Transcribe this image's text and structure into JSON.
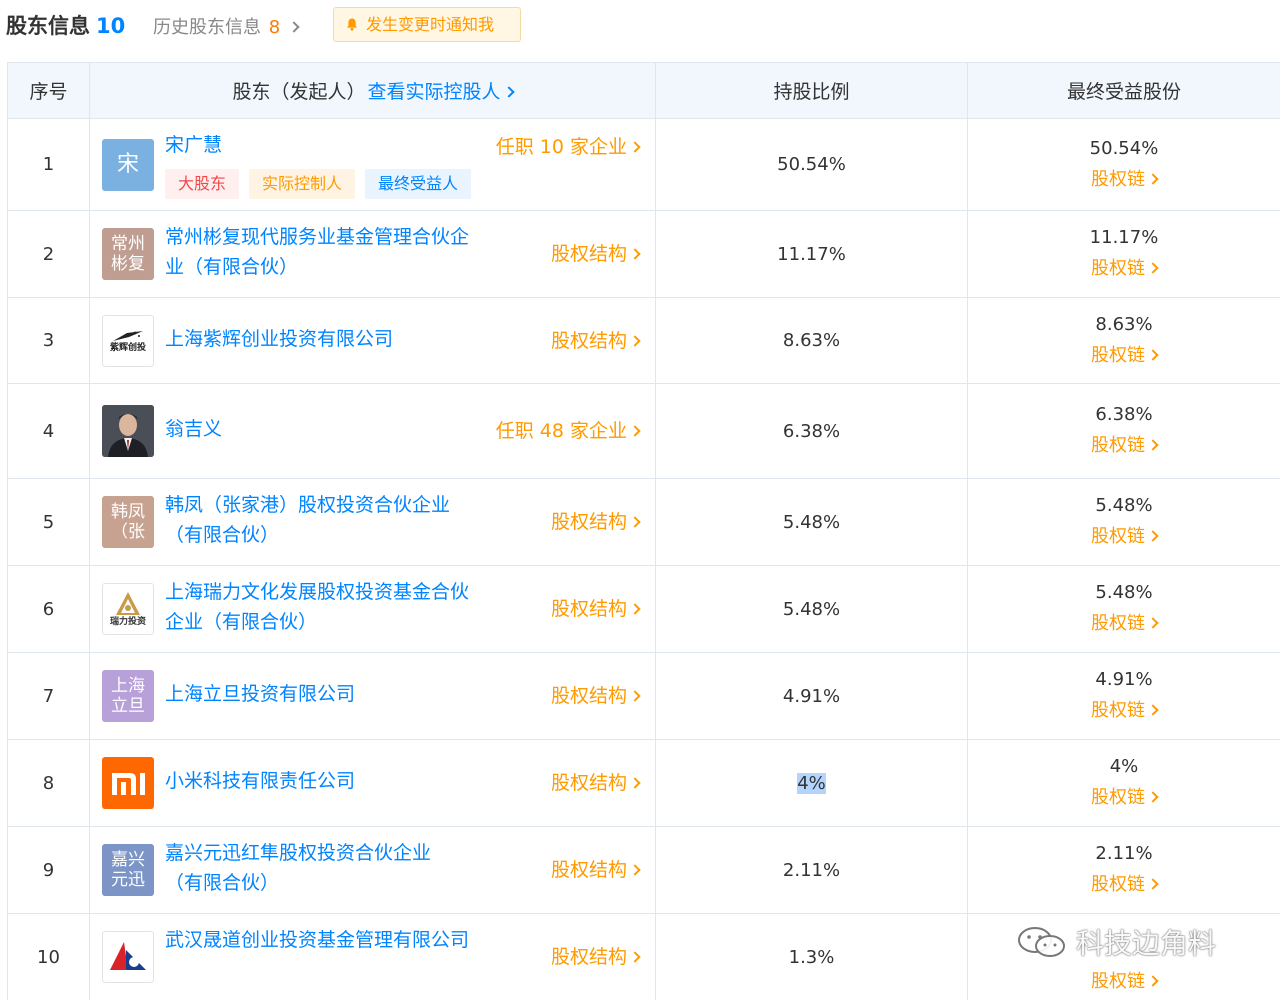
{
  "header": {
    "title": "股东信息",
    "title_count": "10",
    "history_label": "历史股东信息",
    "history_count": "8",
    "notify_label": "发生变更时通知我"
  },
  "table": {
    "columns": {
      "index": "序号",
      "shareholder": "股东（发起人）",
      "controller_link": "查看实际控股人",
      "ratio": "持股比例",
      "beneficial": "最终受益股份"
    },
    "chain_label": "股权链",
    "rows": [
      {
        "index": "1",
        "name": "宋广慧",
        "logo": "宋",
        "action": "任职 10 家企业",
        "ratio": "50.54%",
        "beneficial": "50.54%",
        "tags": [
          "大股东",
          "实际控制人",
          "最终受益人"
        ]
      },
      {
        "index": "2",
        "name": "常州彬复现代服务业基金管理合伙企业（有限合伙）",
        "logo": "常州彬复",
        "action": "股权结构",
        "ratio": "11.17%",
        "beneficial": "11.17%"
      },
      {
        "index": "3",
        "name": "上海紫辉创业投资有限公司",
        "logo": "紫辉创投",
        "action": "股权结构",
        "ratio": "8.63%",
        "beneficial": "8.63%"
      },
      {
        "index": "4",
        "name": "翁吉义",
        "logo": "",
        "action": "任职 48 家企业",
        "ratio": "6.38%",
        "beneficial": "6.38%"
      },
      {
        "index": "5",
        "name": "韩凤（张家港）股权投资合伙企业（有限合伙）",
        "logo": "韩凤（张",
        "action": "股权结构",
        "ratio": "5.48%",
        "beneficial": "5.48%"
      },
      {
        "index": "6",
        "name": "上海瑞力文化发展股权投资基金合伙企业（有限合伙）",
        "logo": "瑞力投资",
        "action": "股权结构",
        "ratio": "5.48%",
        "beneficial": "5.48%"
      },
      {
        "index": "7",
        "name": "上海立旦投资有限公司",
        "logo": "上海立旦",
        "action": "股权结构",
        "ratio": "4.91%",
        "beneficial": "4.91%"
      },
      {
        "index": "8",
        "name": "小米科技有限责任公司",
        "logo": "mi",
        "action": "股权结构",
        "ratio": "4%",
        "beneficial": "4%"
      },
      {
        "index": "9",
        "name": "嘉兴元迅红隼股权投资合伙企业（有限合伙）",
        "logo": "嘉兴元迅",
        "action": "股权结构",
        "ratio": "2.11%",
        "beneficial": "2.11%"
      },
      {
        "index": "10",
        "name": "武汉晟道创业投资基金管理有限公司",
        "logo": "",
        "action": "股权结构",
        "ratio": "1.3%",
        "beneficial": ""
      }
    ]
  },
  "watermark": "科技边角料",
  "colors": {
    "link_blue": "#0084ff",
    "action_orange": "#ff9a00",
    "header_bg": "#f2f7fd",
    "border": "#e0e6ee",
    "logo_song": "#7ab1e0",
    "logo_changzhou": "#bf9e91",
    "logo_hanfeng": "#c7a291",
    "logo_lidan": "#b8a0d8",
    "logo_xiaomi": "#ff6700",
    "logo_jiaxing": "#7c95c6"
  }
}
